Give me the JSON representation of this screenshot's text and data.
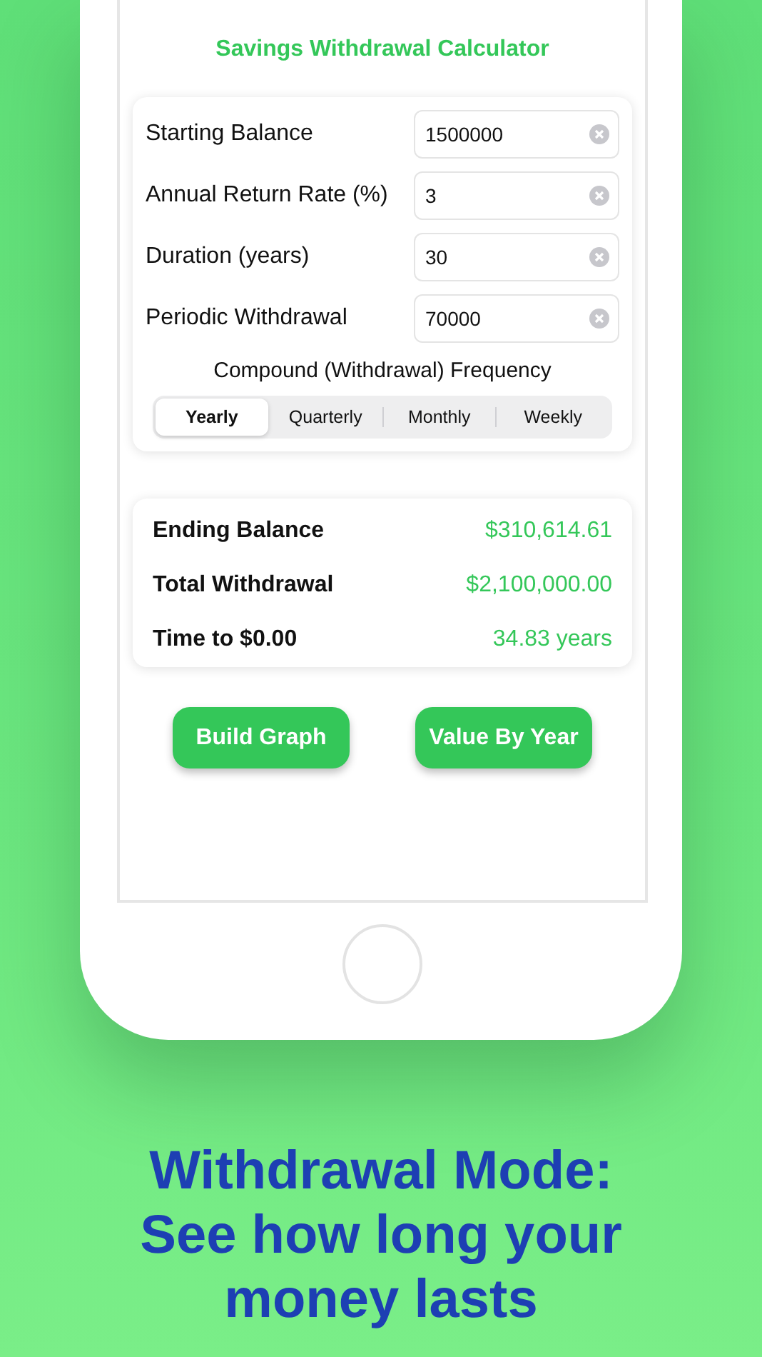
{
  "screen": {
    "title": "Savings Withdrawal Calculator",
    "inputs": [
      {
        "label": "Starting Balance",
        "value": "1500000"
      },
      {
        "label": "Annual Return Rate (%)",
        "value": "3"
      },
      {
        "label": "Duration (years)",
        "value": "30"
      },
      {
        "label": "Periodic Withdrawal",
        "value": "70000"
      }
    ],
    "frequency": {
      "label": "Compound (Withdrawal) Frequency",
      "options": [
        {
          "label": "Yearly",
          "selected": true
        },
        {
          "label": "Quarterly",
          "selected": false
        },
        {
          "label": "Monthly",
          "selected": false
        },
        {
          "label": "Weekly",
          "selected": false
        }
      ]
    },
    "results": [
      {
        "label": "Ending Balance",
        "value": "$310,614.61"
      },
      {
        "label": "Total Withdrawal",
        "value": "$2,100,000.00"
      },
      {
        "label": "Time to $0.00",
        "value": "34.83 years"
      }
    ],
    "buttons": [
      "Build Graph",
      "Value By Year"
    ]
  },
  "caption": "Withdrawal Mode: See how long your money lasts"
}
